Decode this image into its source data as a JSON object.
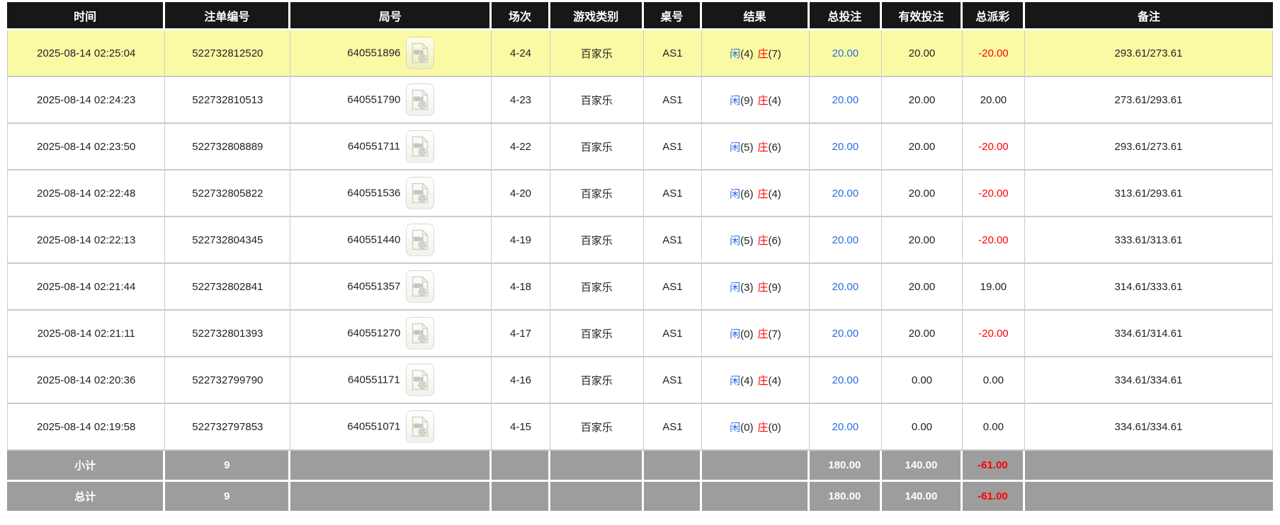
{
  "colors": {
    "accent_blue": "#2a6ce0",
    "loss_red": "#ff0000",
    "highlight_yellow": "#fafaa5",
    "header_bg": "#171717",
    "footer_bg": "#9d9d9d",
    "grid_line": "#cccccc"
  },
  "icons": {
    "round_video": "video-file-icon"
  },
  "table": {
    "columns": [
      {
        "key": "time",
        "label": "时间"
      },
      {
        "key": "bet_id",
        "label": "注单编号"
      },
      {
        "key": "round_id",
        "label": "局号"
      },
      {
        "key": "session",
        "label": "场次"
      },
      {
        "key": "game_type",
        "label": "游戏类别"
      },
      {
        "key": "table_no",
        "label": "桌号"
      },
      {
        "key": "result",
        "label": "结果"
      },
      {
        "key": "total_bet",
        "label": "总投注"
      },
      {
        "key": "valid_bet",
        "label": "有效投注"
      },
      {
        "key": "total_payout",
        "label": "总派彩"
      },
      {
        "key": "remark",
        "label": "备注"
      }
    ],
    "result_labels": {
      "player": "闲",
      "banker": "庄"
    },
    "rows": [
      {
        "time": "2025-08-14 02:25:04",
        "bet_id": "522732812520",
        "round_id": "640551896",
        "session": "4-24",
        "game_type": "百家乐",
        "table_no": "AS1",
        "player": 4,
        "banker": 7,
        "total_bet": "20.00",
        "valid_bet": "20.00",
        "payout": "-20.00",
        "remark": "293.61/273.61",
        "highlighted": true
      },
      {
        "time": "2025-08-14 02:24:23",
        "bet_id": "522732810513",
        "round_id": "640551790",
        "session": "4-23",
        "game_type": "百家乐",
        "table_no": "AS1",
        "player": 9,
        "banker": 4,
        "total_bet": "20.00",
        "valid_bet": "20.00",
        "payout": "20.00",
        "remark": "273.61/293.61",
        "highlighted": false
      },
      {
        "time": "2025-08-14 02:23:50",
        "bet_id": "522732808889",
        "round_id": "640551711",
        "session": "4-22",
        "game_type": "百家乐",
        "table_no": "AS1",
        "player": 5,
        "banker": 6,
        "total_bet": "20.00",
        "valid_bet": "20.00",
        "payout": "-20.00",
        "remark": "293.61/273.61",
        "highlighted": false
      },
      {
        "time": "2025-08-14 02:22:48",
        "bet_id": "522732805822",
        "round_id": "640551536",
        "session": "4-20",
        "game_type": "百家乐",
        "table_no": "AS1",
        "player": 6,
        "banker": 4,
        "total_bet": "20.00",
        "valid_bet": "20.00",
        "payout": "-20.00",
        "remark": "313.61/293.61",
        "highlighted": false
      },
      {
        "time": "2025-08-14 02:22:13",
        "bet_id": "522732804345",
        "round_id": "640551440",
        "session": "4-19",
        "game_type": "百家乐",
        "table_no": "AS1",
        "player": 5,
        "banker": 6,
        "total_bet": "20.00",
        "valid_bet": "20.00",
        "payout": "-20.00",
        "remark": "333.61/313.61",
        "highlighted": false
      },
      {
        "time": "2025-08-14 02:21:44",
        "bet_id": "522732802841",
        "round_id": "640551357",
        "session": "4-18",
        "game_type": "百家乐",
        "table_no": "AS1",
        "player": 3,
        "banker": 9,
        "total_bet": "20.00",
        "valid_bet": "20.00",
        "payout": "19.00",
        "remark": "314.61/333.61",
        "highlighted": false
      },
      {
        "time": "2025-08-14 02:21:11",
        "bet_id": "522732801393",
        "round_id": "640551270",
        "session": "4-17",
        "game_type": "百家乐",
        "table_no": "AS1",
        "player": 0,
        "banker": 7,
        "total_bet": "20.00",
        "valid_bet": "20.00",
        "payout": "-20.00",
        "remark": "334.61/314.61",
        "highlighted": false
      },
      {
        "time": "2025-08-14 02:20:36",
        "bet_id": "522732799790",
        "round_id": "640551171",
        "session": "4-16",
        "game_type": "百家乐",
        "table_no": "AS1",
        "player": 4,
        "banker": 4,
        "total_bet": "20.00",
        "valid_bet": "0.00",
        "payout": "0.00",
        "remark": "334.61/334.61",
        "highlighted": false
      },
      {
        "time": "2025-08-14 02:19:58",
        "bet_id": "522732797853",
        "round_id": "640551071",
        "session": "4-15",
        "game_type": "百家乐",
        "table_no": "AS1",
        "player": 0,
        "banker": 0,
        "total_bet": "20.00",
        "valid_bet": "0.00",
        "payout": "0.00",
        "remark": "334.61/334.61",
        "highlighted": false
      }
    ],
    "subtotal": {
      "label": "小计",
      "count": "9",
      "total_bet": "180.00",
      "valid_bet": "140.00",
      "payout": "-61.00"
    },
    "total": {
      "label": "总计",
      "count": "9",
      "total_bet": "180.00",
      "valid_bet": "140.00",
      "payout": "-61.00"
    }
  }
}
